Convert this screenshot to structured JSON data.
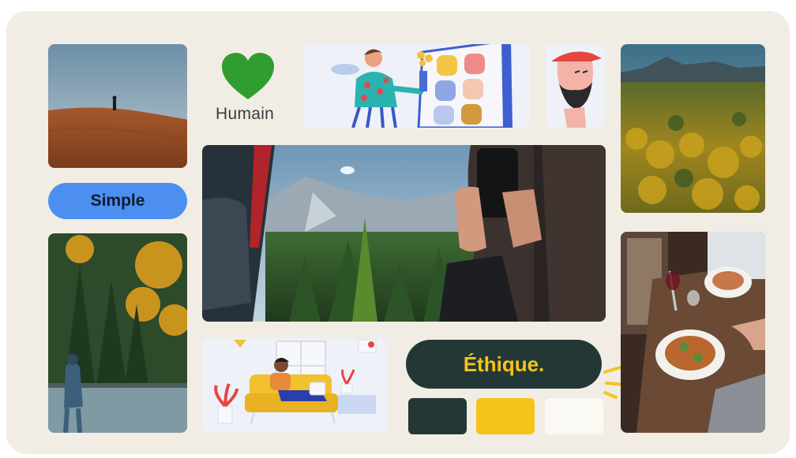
{
  "labels": {
    "humain": "Humain",
    "simple": "Simple",
    "ethique": "Éthique."
  },
  "icons": {
    "heart": "heart-icon",
    "sparkle": "sparkle-lines-icon"
  },
  "colors": {
    "board_background": "#f1ede4",
    "heart": "#2f9d2f",
    "simple_pill": "#4c8ff1",
    "ethique_pill": "#233836",
    "ethique_text": "#f5c31a",
    "swatches": [
      "#233836",
      "#f5c31a",
      "#fbf9f4"
    ]
  },
  "tiles": [
    "photo-person-on-dune",
    "illustration-woman-with-app-grid",
    "illustration-bearded-man-cap",
    "photo-autumn-valley",
    "photo-forest-through-car-window",
    "photo-fisherman-autumn-lake",
    "illustration-person-on-sofa",
    "photo-dinner-table"
  ]
}
